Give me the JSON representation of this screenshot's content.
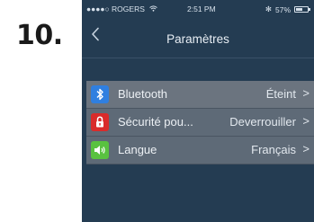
{
  "step": {
    "number": "10."
  },
  "status_bar": {
    "carrier": "●●●●○ ROGERS",
    "time": "2:51 PM",
    "bluetooth_symbol": "✻",
    "battery_percent": "57%",
    "battery_level": 0.57,
    "wifi_icon": "wifi-icon",
    "battery_icon": "battery-icon"
  },
  "nav": {
    "back_icon": "chevron-left-icon",
    "back_glyph": "‹",
    "title": "Paramètres"
  },
  "settings": [
    {
      "icon": "bluetooth-icon",
      "icon_color": "#2f7fe0",
      "label": "Bluetooth",
      "value": "Éteint",
      "chevron": ">"
    },
    {
      "icon": "lock-icon",
      "icon_color": "#d92b2b",
      "label": "Sécurité pou...",
      "value": "Deverrouiller",
      "chevron": ">"
    },
    {
      "icon": "speaker-icon",
      "icon_color": "#59c240",
      "label": "Langue",
      "value": "Français",
      "chevron": ">"
    }
  ],
  "colors": {
    "screen_background": "#243c52",
    "row_background": "#5e6a77"
  }
}
